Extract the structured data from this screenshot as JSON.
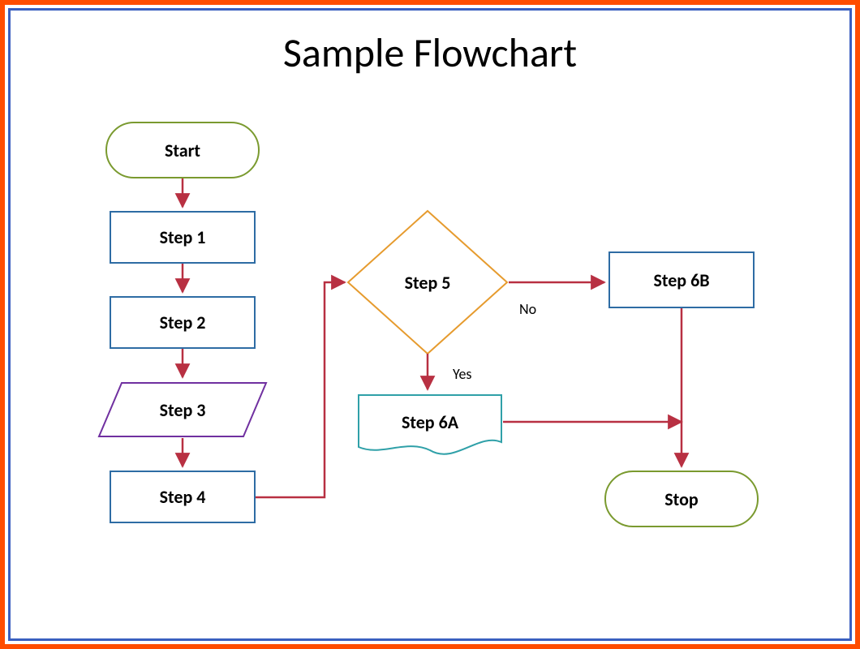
{
  "title": "Sample Flowchart",
  "nodes": {
    "start": "Start",
    "step1": "Step 1",
    "step2": "Step 2",
    "step3": "Step 3",
    "step4": "Step 4",
    "step5": "Step 5",
    "step6a": "Step 6A",
    "step6b": "Step 6B",
    "stop": "Stop"
  },
  "edges": {
    "yes": "Yes",
    "no": "No"
  },
  "chart_data": {
    "type": "flowchart",
    "title": "Sample Flowchart",
    "nodes": [
      {
        "id": "start",
        "label": "Start",
        "shape": "terminator"
      },
      {
        "id": "step1",
        "label": "Step 1",
        "shape": "process"
      },
      {
        "id": "step2",
        "label": "Step 2",
        "shape": "process"
      },
      {
        "id": "step3",
        "label": "Step 3",
        "shape": "data"
      },
      {
        "id": "step4",
        "label": "Step 4",
        "shape": "process"
      },
      {
        "id": "step5",
        "label": "Step 5",
        "shape": "decision"
      },
      {
        "id": "step6a",
        "label": "Step 6A",
        "shape": "document"
      },
      {
        "id": "step6b",
        "label": "Step 6B",
        "shape": "process"
      },
      {
        "id": "stop",
        "label": "Stop",
        "shape": "terminator"
      }
    ],
    "edges": [
      {
        "from": "start",
        "to": "step1"
      },
      {
        "from": "step1",
        "to": "step2"
      },
      {
        "from": "step2",
        "to": "step3"
      },
      {
        "from": "step3",
        "to": "step4"
      },
      {
        "from": "step4",
        "to": "step5"
      },
      {
        "from": "step5",
        "to": "step6a",
        "label": "Yes"
      },
      {
        "from": "step5",
        "to": "step6b",
        "label": "No"
      },
      {
        "from": "step6a",
        "to": "stop"
      },
      {
        "from": "step6b",
        "to": "stop"
      }
    ]
  }
}
